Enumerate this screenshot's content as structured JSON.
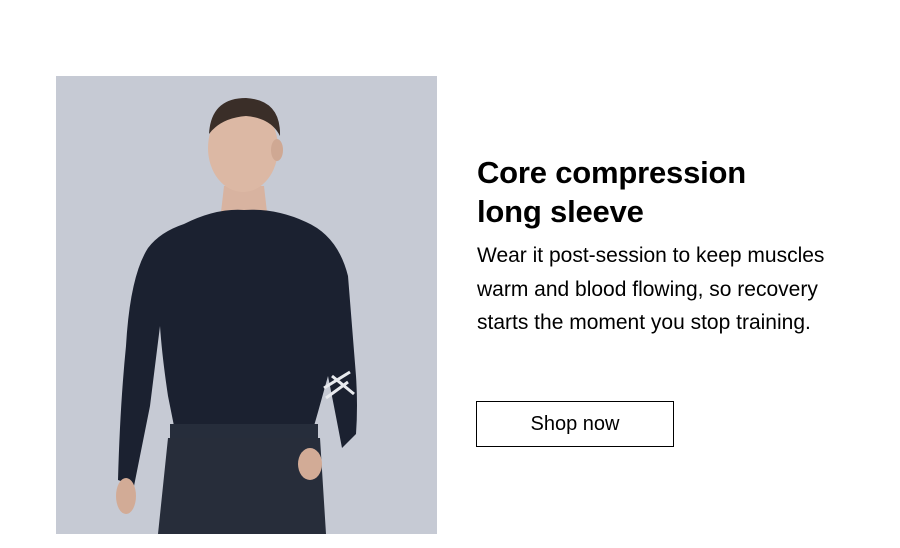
{
  "promo": {
    "headline_line1": "Core compression",
    "headline_line2": "long sleeve",
    "description": "Wear it post-session to keep muscles warm and blood flowing, so recovery starts the moment you stop training.",
    "cta_label": "Shop now"
  },
  "colors": {
    "background": "#ffffff",
    "text": "#000000",
    "photo_backdrop": "#bfc4ce",
    "garment": "#1b2130"
  },
  "icons": {
    "sleeve_logo": "2xu-logo-icon"
  }
}
